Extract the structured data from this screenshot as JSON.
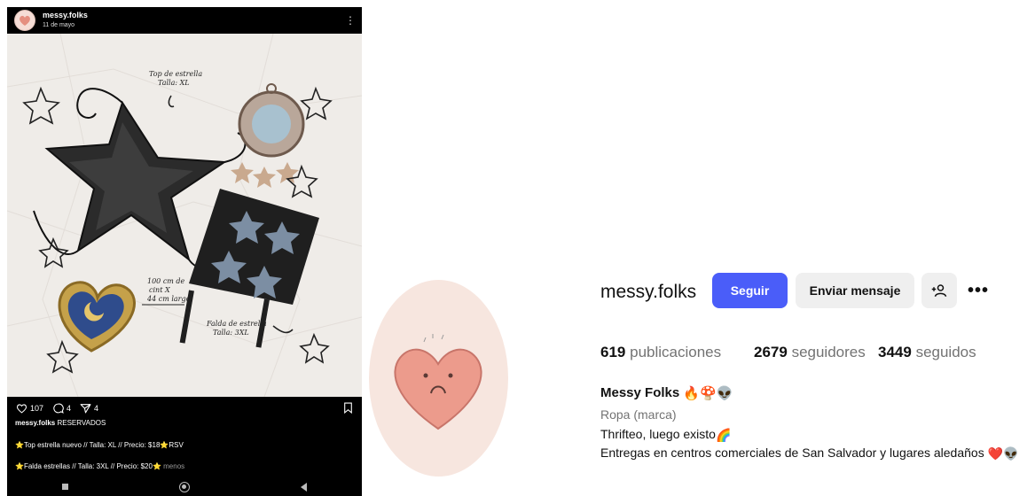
{
  "post": {
    "username": "messy.folks",
    "date": "11 de mayo",
    "image_handwriting": {
      "top_label": "Top de estrella\nTalla: XL",
      "measure_label": "100 cm de\ncint X\n44 cm largo",
      "skirt_label": "Falda de estrella\nTalla: 3XL"
    },
    "likes": "107",
    "comments": "4",
    "shares": "4",
    "caption_suffix": "RESERVADOS",
    "caption_line1": "Top estrella nuevo // Talla: XL // Precio: $18",
    "caption_line1_tail": "RSV",
    "caption_line2": "Falda estrellas // Talla: 3XL // Precio: $20",
    "caption_more": "menos"
  },
  "profile": {
    "username": "messy.folks",
    "follow_label": "Seguir",
    "message_label": "Enviar mensaje",
    "posts_count": "619",
    "posts_label": "publicaciones",
    "followers_count": "2679",
    "followers_label": "seguidores",
    "following_count": "3449",
    "following_label": "seguidos",
    "display_name": "Messy Folks",
    "category": "Ropa (marca)",
    "bio_line1": "Thrifteo, luego existo",
    "bio_line2": "Entregas en centros comerciales de San Salvador y lugares aledaños"
  },
  "colors": {
    "follow_button": "#4a5df9",
    "secondary_button": "#efefef",
    "muted_text": "#737373"
  }
}
